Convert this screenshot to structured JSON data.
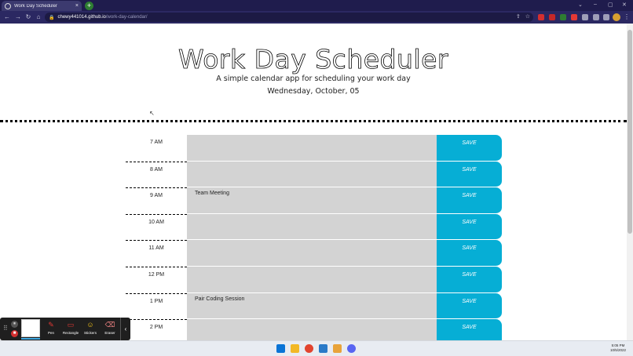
{
  "browser": {
    "tab_title": "Work Day Scheduler",
    "tab_close": "×",
    "new_tab": "+",
    "url_host": "chewy441014.github.io",
    "url_path": "/work-day-calendar/",
    "window_controls": [
      "⌄",
      "–",
      "▢",
      "✕"
    ]
  },
  "page": {
    "title": "Work Day Scheduler",
    "subtitle": "A simple calendar app for scheduling your work day",
    "current_day": "Wednesday, October, 05"
  },
  "schedule": [
    {
      "hour": "7 AM",
      "text": "",
      "save": "SAVE"
    },
    {
      "hour": "8 AM",
      "text": "",
      "save": "SAVE"
    },
    {
      "hour": "9 AM",
      "text": "Team Meeting",
      "save": "SAVE"
    },
    {
      "hour": "10 AM",
      "text": "",
      "save": "SAVE"
    },
    {
      "hour": "11 AM",
      "text": "",
      "save": "SAVE"
    },
    {
      "hour": "12 PM",
      "text": "",
      "save": "SAVE"
    },
    {
      "hour": "1 PM",
      "text": "Pair Coding Session",
      "save": "SAVE"
    },
    {
      "hour": "2 PM",
      "text": "",
      "save": "SAVE"
    }
  ],
  "annotation_toolbar": {
    "tools": [
      {
        "label": "Pen",
        "icon": "pen-icon"
      },
      {
        "label": "Rectangle",
        "icon": "rectangle-icon"
      },
      {
        "label": "Stickers",
        "icon": "sticker-icon"
      },
      {
        "label": "Eraser",
        "icon": "eraser-icon"
      }
    ],
    "collapse": "‹"
  },
  "taskbar": {
    "time": "5:05 PM",
    "date": "10/5/2022"
  },
  "colors": {
    "save_button": "#06aed5",
    "textarea": "#d3d3d3",
    "browser_frame": "#2b2862"
  }
}
